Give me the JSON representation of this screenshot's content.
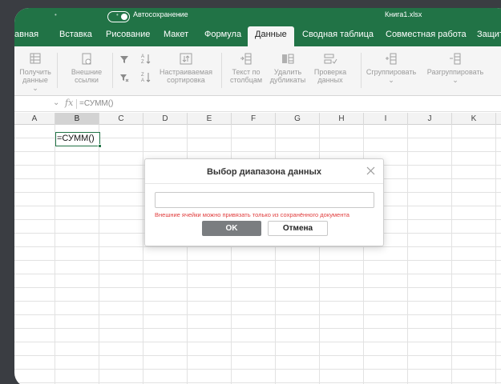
{
  "titlebar": {
    "autosave_label": "Автосохранение",
    "filename": "Книга1.xlsx"
  },
  "tabs": [
    {
      "label": "авная"
    },
    {
      "label": "Вставка"
    },
    {
      "label": "Рисование"
    },
    {
      "label": "Макет"
    },
    {
      "label": "Формула"
    },
    {
      "label": "Данные",
      "active": true
    },
    {
      "label": "Сводная таблица"
    },
    {
      "label": "Совместная работа"
    },
    {
      "label": "Защит"
    }
  ],
  "ribbon": {
    "get_data": {
      "line1": "Получить",
      "line2": "данные ⌄"
    },
    "external_links": {
      "line1": "Внешние",
      "line2": "ссылки"
    },
    "custom_sort": {
      "line1": "Настраиваемая",
      "line2": "сортировка"
    },
    "text_to_columns": {
      "line1": "Текст по",
      "line2": "столбцам"
    },
    "remove_duplicates": {
      "line1": "Удалить",
      "line2": "дубликаты"
    },
    "data_validation": {
      "line1": "Проверка",
      "line2": "данных"
    },
    "group": {
      "line1": "Сгруппировать",
      "line2": "⌄"
    },
    "ungroup": {
      "line1": "Разгруппировать",
      "line2": "⌄"
    }
  },
  "formula_bar": {
    "fx": "fx",
    "content": "=СУММ()"
  },
  "columns": [
    "A",
    "B",
    "C",
    "D",
    "E",
    "F",
    "G",
    "H",
    "I",
    "J",
    "K"
  ],
  "selected_column": "B",
  "active_cell": {
    "value": "=СУММ()"
  },
  "dialog": {
    "title": "Выбор диапазона данных",
    "input_value": "",
    "error": "Внешние ячейки можно привязать только из сохранённого документа",
    "ok_label": "OK",
    "cancel_label": "Отмена"
  },
  "colors": {
    "brand_green": "#217346",
    "error_red": "#e03c3c",
    "ok_button": "#7a7d80"
  }
}
